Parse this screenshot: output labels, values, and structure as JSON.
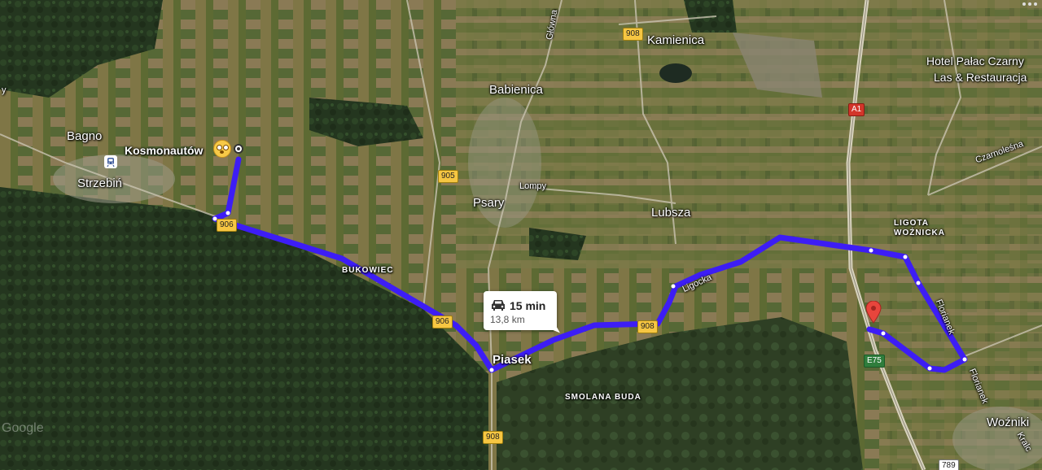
{
  "route": {
    "duration": "15 min",
    "distance": "13,8 km",
    "color": "#3d1df5"
  },
  "places": {
    "kamienica": "Kamienica",
    "babienica": "Babienica",
    "bagno": "Bagno",
    "kosmonautow": "Kosmonautów",
    "strzebin": "Strzebiń",
    "psary": "Psary",
    "lubsza": "Lubsza",
    "hotel_line1": "Hotel Pałac Czarny",
    "hotel_line2": "Las & Restauracja",
    "piasek": "Piasek",
    "smolana_buda": "SMOLANA BUDA",
    "bukowiec": "BUKOWIEC",
    "ligota_line1": "LIGOTA",
    "ligota_line2": "WOŹNICKA",
    "wozniki": "Woźniki"
  },
  "roads": {
    "glowna": "Główna",
    "lompy": "Lompy",
    "ligocka": "Ligocka",
    "florianek_1": "Florianek",
    "florianek_2": "Florianek",
    "czarnolesna": "Czarnoleśna",
    "kralc": "Kralc",
    "y_edge": "y"
  },
  "shields": {
    "r908_top": "908",
    "r905": "905",
    "r906_left": "906",
    "r906_mid": "906",
    "r908_right": "908",
    "r908_bottom": "908",
    "a1": "A1",
    "e75": "E75",
    "r789": "789"
  },
  "attribution": "Google"
}
